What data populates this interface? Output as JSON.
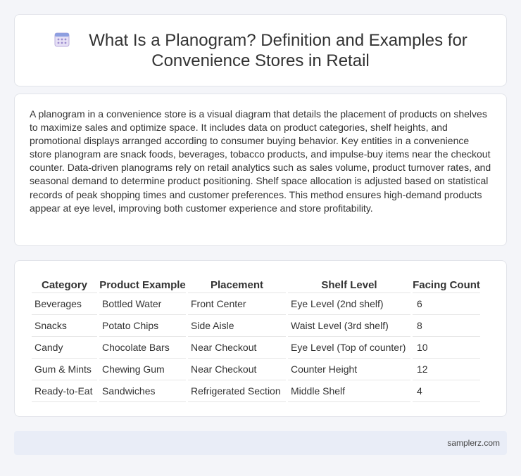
{
  "header": {
    "icon": "calendar-icon",
    "title_line1": "What Is a Planogram? Definition and Examples for",
    "title_line2": "Convenience Stores in Retail"
  },
  "summary": {
    "text": "A planogram in a convenience store is a visual diagram that details the placement of products on shelves to maximize sales and optimize space. It includes data on product categories, shelf heights, and promotional displays arranged according to consumer buying behavior. Key entities in a convenience store planogram are snack foods, beverages, tobacco products, and impulse-buy items near the checkout counter. Data-driven planograms rely on retail analytics such as sales volume, product turnover rates, and seasonal demand to determine product positioning. Shelf space allocation is adjusted based on statistical records of peak shopping times and customer preferences. This method ensures high-demand products appear at eye level, improving both customer experience and store profitability."
  },
  "table": {
    "headers": [
      "Category",
      "Product Example",
      "Placement",
      "Shelf Level",
      "Facing Count"
    ],
    "rows": [
      [
        "Beverages",
        "Bottled Water",
        "Front Center",
        "Eye Level (2nd shelf)",
        "6"
      ],
      [
        "Snacks",
        "Potato Chips",
        "Side Aisle",
        "Waist Level (3rd shelf)",
        "8"
      ],
      [
        "Candy",
        "Chocolate Bars",
        "Near Checkout",
        "Eye Level (Top of counter)",
        "10"
      ],
      [
        "Gum & Mints",
        "Chewing Gum",
        "Near Checkout",
        "Counter Height",
        "12"
      ],
      [
        "Ready-to-Eat",
        "Sandwiches",
        "Refrigerated Section",
        "Middle Shelf",
        "4"
      ]
    ]
  },
  "footer": {
    "site": "samplerz.com"
  },
  "colors": {
    "page_background": "#f4f5f9",
    "card_background": "#ffffff",
    "footer_background": "#e9edf7",
    "icon_accent": "#8e7cc3"
  }
}
